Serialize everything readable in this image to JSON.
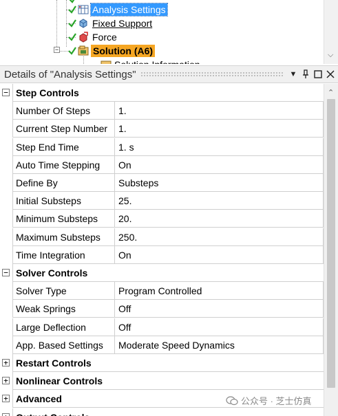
{
  "tree": {
    "items": [
      {
        "label": "Analysis Settings",
        "selected": true,
        "underline": false,
        "icon": "analysis-settings-icon"
      },
      {
        "label": "Fixed Support",
        "selected": false,
        "underline": true,
        "icon": "fixed-support-icon"
      },
      {
        "label": "Force",
        "selected": false,
        "underline": false,
        "icon": "force-icon"
      },
      {
        "label": "Solution (A6)",
        "selected": false,
        "highlight": true,
        "icon": "solution-icon"
      },
      {
        "label": "Solution Information",
        "icon": "solution-information-icon"
      }
    ],
    "selection_color": "#3399ff",
    "solution_highlight_color": "#f5a623"
  },
  "details": {
    "title": "Details of \"Analysis Settings\"",
    "buttons": {
      "dropdown": "▼",
      "pin": "pin",
      "maximize": "□",
      "close": "✕"
    }
  },
  "grid": {
    "groups": [
      {
        "title": "Step Controls",
        "expanded": true,
        "rows": [
          {
            "name": "Number Of Steps",
            "value": "1."
          },
          {
            "name": "Current Step Number",
            "value": "1."
          },
          {
            "name": "Step End Time",
            "value": "1. s"
          },
          {
            "name": "Auto Time Stepping",
            "value": "On"
          },
          {
            "name": "Define By",
            "value": "Substeps"
          },
          {
            "name": "Initial Substeps",
            "value": "25."
          },
          {
            "name": "Minimum Substeps",
            "value": "20."
          },
          {
            "name": "Maximum Substeps",
            "value": "250."
          },
          {
            "name": "Time Integration",
            "value": "On"
          }
        ]
      },
      {
        "title": "Solver Controls",
        "expanded": true,
        "rows": [
          {
            "name": "Solver Type",
            "value": "Program Controlled"
          },
          {
            "name": "Weak Springs",
            "value": "Off"
          },
          {
            "name": "Large Deflection",
            "value": "Off"
          },
          {
            "name": "App. Based Settings",
            "value": "Moderate Speed Dynamics"
          }
        ]
      },
      {
        "title": "Restart Controls",
        "expanded": false,
        "rows": []
      },
      {
        "title": "Nonlinear Controls",
        "expanded": false,
        "rows": []
      },
      {
        "title": "Advanced",
        "expanded": false,
        "rows": []
      },
      {
        "title": "Output Controls",
        "expanded": false,
        "rows": []
      }
    ]
  },
  "watermark": {
    "text": "公众号 · 芝士仿真"
  }
}
